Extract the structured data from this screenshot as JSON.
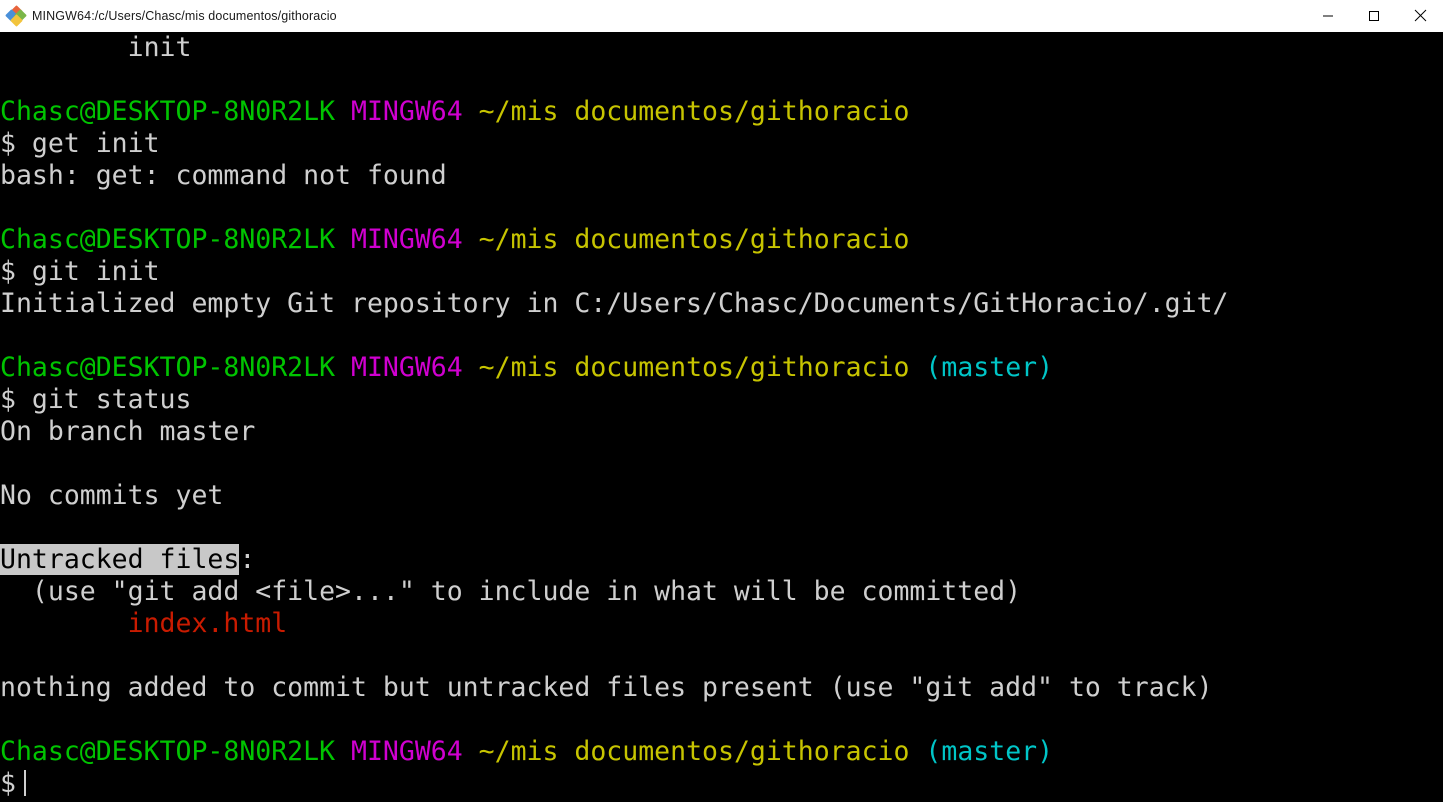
{
  "window": {
    "title": "MINGW64:/c/Users/Chasc/mis documentos/githoracio",
    "icon": "mintty-diamond-icon",
    "controls": {
      "minimize_label": "—",
      "maximize_label": "□",
      "close_label": "✕"
    }
  },
  "theme": {
    "background": "#000000",
    "foreground": "#cfcfcf",
    "green": "#00c400",
    "magenta": "#d000d0",
    "yellow": "#c7c400",
    "cyan": "#00c5c7",
    "red": "#c91b00",
    "selection_bg": "#c8c8c8",
    "selection_fg": "#000000",
    "titlebar_bg": "#ffffff",
    "titlebar_fg": "#1a1a1a"
  },
  "terminal": {
    "user": "Chasc",
    "host": "DESKTOP-8N0R2LK",
    "shell_tag": "MINGW64",
    "cwd": "~/mis documentos/githoracio",
    "branch": "(master)",
    "prompt_symbol": "$",
    "lines": [
      {
        "id": "scrollback-init",
        "segments": [
          {
            "text": "        init",
            "color": "default"
          }
        ]
      },
      {
        "id": "blank-1",
        "segments": [
          {
            "text": "",
            "color": "default"
          }
        ]
      },
      {
        "id": "prompt-1",
        "segments": [
          {
            "text": "Chasc@DESKTOP-8N0R2LK",
            "color": "green"
          },
          {
            "text": " ",
            "color": "default"
          },
          {
            "text": "MINGW64",
            "color": "magenta"
          },
          {
            "text": " ",
            "color": "default"
          },
          {
            "text": "~/mis documentos/githoracio",
            "color": "yellow"
          }
        ]
      },
      {
        "id": "command-get-init",
        "segments": [
          {
            "text": "$ get init",
            "color": "default"
          }
        ]
      },
      {
        "id": "output-get-not-found",
        "segments": [
          {
            "text": "bash: get: command not found",
            "color": "default"
          }
        ]
      },
      {
        "id": "blank-2",
        "segments": [
          {
            "text": "",
            "color": "default"
          }
        ]
      },
      {
        "id": "prompt-2",
        "segments": [
          {
            "text": "Chasc@DESKTOP-8N0R2LK",
            "color": "green"
          },
          {
            "text": " ",
            "color": "default"
          },
          {
            "text": "MINGW64",
            "color": "magenta"
          },
          {
            "text": " ",
            "color": "default"
          },
          {
            "text": "~/mis documentos/githoracio",
            "color": "yellow"
          }
        ]
      },
      {
        "id": "command-git-init",
        "segments": [
          {
            "text": "$ git init",
            "color": "default"
          }
        ]
      },
      {
        "id": "output-initialized",
        "segments": [
          {
            "text": "Initialized empty Git repository in C:/Users/Chasc/Documents/GitHoracio/.git/",
            "color": "default"
          }
        ]
      },
      {
        "id": "blank-3",
        "segments": [
          {
            "text": "",
            "color": "default"
          }
        ]
      },
      {
        "id": "prompt-3",
        "segments": [
          {
            "text": "Chasc@DESKTOP-8N0R2LK",
            "color": "green"
          },
          {
            "text": " ",
            "color": "default"
          },
          {
            "text": "MINGW64",
            "color": "magenta"
          },
          {
            "text": " ",
            "color": "default"
          },
          {
            "text": "~/mis documentos/githoracio",
            "color": "yellow"
          },
          {
            "text": " ",
            "color": "default"
          },
          {
            "text": "(master)",
            "color": "cyan"
          }
        ]
      },
      {
        "id": "command-git-status",
        "segments": [
          {
            "text": "$ git status",
            "color": "default"
          }
        ]
      },
      {
        "id": "output-on-branch",
        "segments": [
          {
            "text": "On branch master",
            "color": "default"
          }
        ]
      },
      {
        "id": "blank-4",
        "segments": [
          {
            "text": "",
            "color": "default"
          }
        ]
      },
      {
        "id": "output-no-commits",
        "segments": [
          {
            "text": "No commits yet",
            "color": "default"
          }
        ]
      },
      {
        "id": "blank-5",
        "segments": [
          {
            "text": "",
            "color": "default"
          }
        ]
      },
      {
        "id": "output-untracked-header",
        "segments": [
          {
            "text": "Untracked files",
            "color": "default",
            "selected": true
          },
          {
            "text": ":",
            "color": "default"
          }
        ]
      },
      {
        "id": "output-use-git-add-hint",
        "segments": [
          {
            "text": "  (use \"git add <file>...\" to include in what will be committed)",
            "color": "default"
          }
        ]
      },
      {
        "id": "output-untracked-file",
        "segments": [
          {
            "text": "        index.html",
            "color": "red"
          }
        ]
      },
      {
        "id": "blank-6",
        "segments": [
          {
            "text": "",
            "color": "default"
          }
        ]
      },
      {
        "id": "output-nothing-added",
        "segments": [
          {
            "text": "nothing added to commit but untracked files present (use \"git add\" to track)",
            "color": "default"
          }
        ]
      },
      {
        "id": "blank-7",
        "segments": [
          {
            "text": "",
            "color": "default"
          }
        ]
      },
      {
        "id": "prompt-4",
        "segments": [
          {
            "text": "Chasc@DESKTOP-8N0R2LK",
            "color": "green"
          },
          {
            "text": " ",
            "color": "default"
          },
          {
            "text": "MINGW64",
            "color": "magenta"
          },
          {
            "text": " ",
            "color": "default"
          },
          {
            "text": "~/mis documentos/githoracio",
            "color": "yellow"
          },
          {
            "text": " ",
            "color": "default"
          },
          {
            "text": "(master)",
            "color": "cyan"
          }
        ]
      },
      {
        "id": "prompt-current",
        "segments": [
          {
            "text": "$",
            "color": "default"
          }
        ],
        "cursor": true
      }
    ]
  }
}
